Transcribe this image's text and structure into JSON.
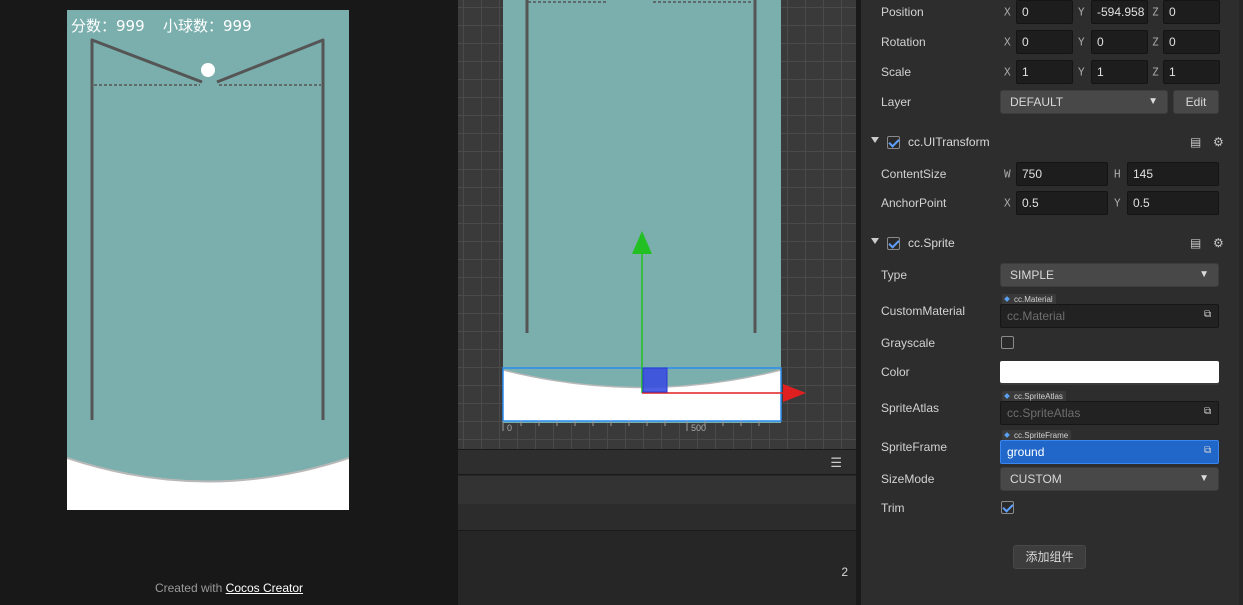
{
  "preview": {
    "hud_score": "分数：999",
    "hud_balls": "小球数：999",
    "credit_prefix": "Created with ",
    "credit_link": "Cocos Creator"
  },
  "scene": {
    "ruler_labels": [
      "0",
      "500"
    ]
  },
  "lower_panel": {
    "menu_icon": "hamburger-icon",
    "count": "2"
  },
  "inspector": {
    "node": {
      "position": {
        "label": "Position",
        "x": "0",
        "y": "-594.958",
        "z": "0"
      },
      "rotation": {
        "label": "Rotation",
        "x": "0",
        "y": "0",
        "z": "0"
      },
      "scale": {
        "label": "Scale",
        "x": "1",
        "y": "1",
        "z": "1"
      },
      "layer": {
        "label": "Layer",
        "value": "DEFAULT",
        "edit_label": "Edit"
      }
    },
    "ui_transform": {
      "title": "cc.UITransform",
      "content_size": {
        "label": "ContentSize",
        "w_axis": "W",
        "w": "750",
        "h_axis": "H",
        "h": "145"
      },
      "anchor_point": {
        "label": "AnchorPoint",
        "x": "0.5",
        "y": "0.5"
      }
    },
    "sprite": {
      "title": "cc.Sprite",
      "type": {
        "label": "Type",
        "value": "SIMPLE"
      },
      "custom_material": {
        "label": "CustomMaterial",
        "tag": "cc.Material",
        "value": "cc.Material"
      },
      "grayscale": {
        "label": "Grayscale",
        "checked": false
      },
      "color": {
        "label": "Color",
        "value": "#ffffff"
      },
      "sprite_atlas": {
        "label": "SpriteAtlas",
        "tag": "cc.SpriteAtlas",
        "value": "cc.SpriteAtlas"
      },
      "sprite_frame": {
        "label": "SpriteFrame",
        "tag": "cc.SpriteFrame",
        "value": "ground"
      },
      "size_mode": {
        "label": "SizeMode",
        "value": "CUSTOM"
      },
      "trim": {
        "label": "Trim",
        "checked": true
      }
    },
    "add_component_label": "添加组件",
    "axis_x": "X",
    "axis_y": "Y",
    "axis_z": "Z"
  },
  "colors": {
    "game_bg": "#7aafad",
    "selection": "#2a8cf0",
    "gizmo_y": "#22c022",
    "gizmo_x": "#e02020",
    "active_field": "#2067c9"
  }
}
